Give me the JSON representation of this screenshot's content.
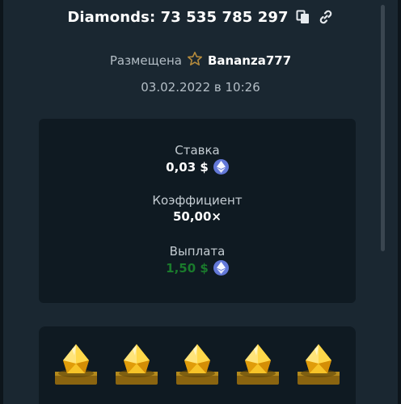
{
  "header": {
    "title": "Diamonds: 73 535 785 297",
    "copy_icon": "copy-icon",
    "link_icon": "link-icon"
  },
  "info": {
    "placed_label": "Размещена",
    "username": "Bananza777",
    "date": "03.02.2022 в 10:26"
  },
  "stats": {
    "bet_label": "Ставка",
    "bet_value": "0,03 $",
    "coefficient_label": "Коэффициент",
    "coefficient_value": "50,00×",
    "payout_label": "Выплата",
    "payout_value": "1,50 $"
  },
  "game": {
    "gems": [
      {
        "icon": "yellow-diamond-icon"
      },
      {
        "icon": "yellow-diamond-icon"
      },
      {
        "icon": "yellow-diamond-icon"
      },
      {
        "icon": "yellow-diamond-icon"
      },
      {
        "icon": "yellow-diamond-icon"
      }
    ]
  },
  "colors": {
    "background": "#1a2731",
    "card": "#0f1a22",
    "payout": "#1a7a2c",
    "ethereum": "#6378d8",
    "gem": "#f5c518"
  }
}
